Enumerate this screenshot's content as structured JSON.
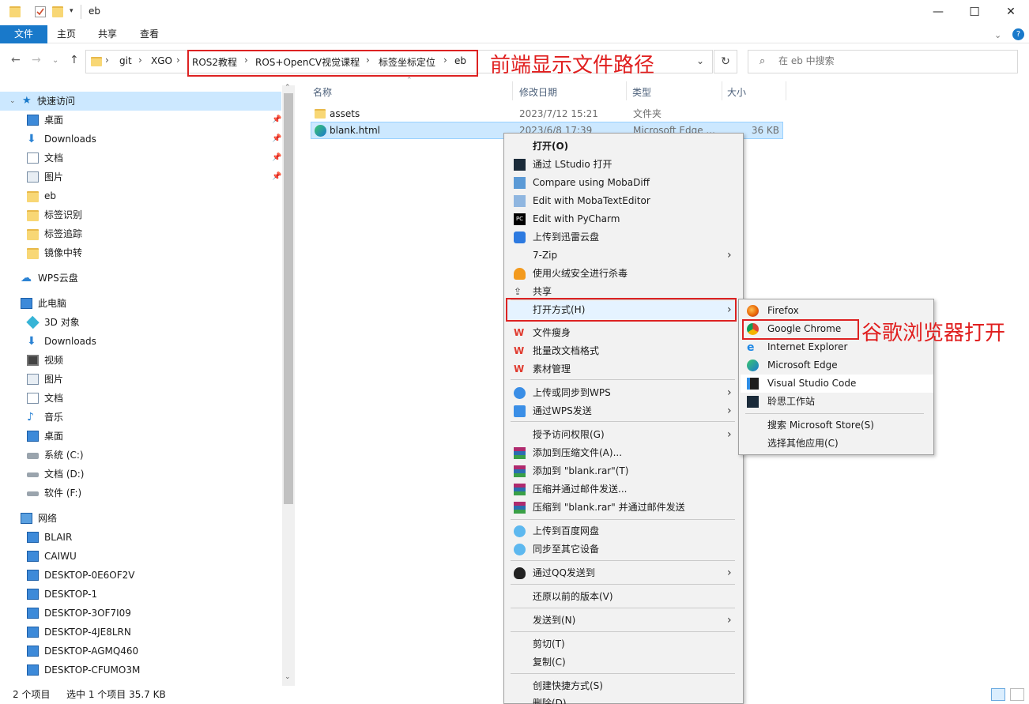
{
  "window": {
    "title": "eb",
    "minimize": "—",
    "maximize": "☐",
    "close": "✕"
  },
  "ribbon": {
    "tabs": [
      "文件",
      "主页",
      "共享",
      "查看"
    ],
    "help": "?"
  },
  "address": {
    "crumbs": [
      "git",
      "XGO",
      "ROS2教程",
      "ROS+OpenCV视觉课程",
      "标签坐标定位",
      "eb"
    ],
    "separator": "›",
    "search_placeholder": "在 eb 中搜索"
  },
  "annotations": {
    "path_label": "前端显示文件路径",
    "chrome_label": "谷歌浏览器打开"
  },
  "nav": {
    "quick_access": "快速访问",
    "quick_items": [
      "桌面",
      "Downloads",
      "文档",
      "图片",
      "eb",
      "标签识别",
      "标签追踪",
      "镜像中转"
    ],
    "wps": "WPS云盘",
    "this_pc": "此电脑",
    "pc_items": [
      "3D 对象",
      "Downloads",
      "视频",
      "图片",
      "文档",
      "音乐",
      "桌面",
      "系统 (C:)",
      "文档 (D:)",
      "软件 (F:)"
    ],
    "network": "网络",
    "network_items": [
      "BLAIR",
      "CAIWU",
      "DESKTOP-0E6OF2V",
      "DESKTOP-1",
      "DESKTOP-3OF7I09",
      "DESKTOP-4JE8LRN",
      "DESKTOP-AGMQ460",
      "DESKTOP-CFUMO3M"
    ]
  },
  "list": {
    "columns": [
      "名称",
      "修改日期",
      "类型",
      "大小"
    ],
    "rows": [
      {
        "name": "assets",
        "date": "2023/7/12 15:21",
        "type": "文件夹",
        "size": ""
      },
      {
        "name": "blank.html",
        "date": "2023/6/8 17:39",
        "type": "Microsoft Edge ...",
        "size": "36 KB"
      }
    ]
  },
  "status": {
    "count": "2 个项目",
    "selection": "选中 1 个项目  35.7 KB"
  },
  "context_menu": {
    "items": [
      "打开(O)",
      "通过 LStudio 打开",
      "Compare using MobaDiff",
      "Edit with MobaTextEditor",
      "Edit with PyCharm",
      "上传到迅雷云盘",
      "7-Zip",
      "使用火绒安全进行杀毒",
      "共享",
      "打开方式(H)",
      "文件瘦身",
      "批量改文档格式",
      "素材管理",
      "上传或同步到WPS",
      "通过WPS发送",
      "授予访问权限(G)",
      "添加到压缩文件(A)...",
      "添加到 \"blank.rar\"(T)",
      "压缩并通过邮件发送...",
      "压缩到 \"blank.rar\" 并通过邮件发送",
      "上传到百度网盘",
      "同步至其它设备",
      "通过QQ发送到",
      "还原以前的版本(V)",
      "发送到(N)",
      "剪切(T)",
      "复制(C)",
      "创建快捷方式(S)",
      "删除(D)"
    ]
  },
  "submenu": {
    "items": [
      "Firefox",
      "Google Chrome",
      "Internet Explorer",
      "Microsoft Edge",
      "Visual Studio Code",
      "聆思工作站",
      "搜索 Microsoft Store(S)",
      "选择其他应用(C)"
    ]
  },
  "colors": {
    "accent": "#1979ca",
    "annotation_red": "#e01e1e",
    "selection": "#cce8ff"
  }
}
